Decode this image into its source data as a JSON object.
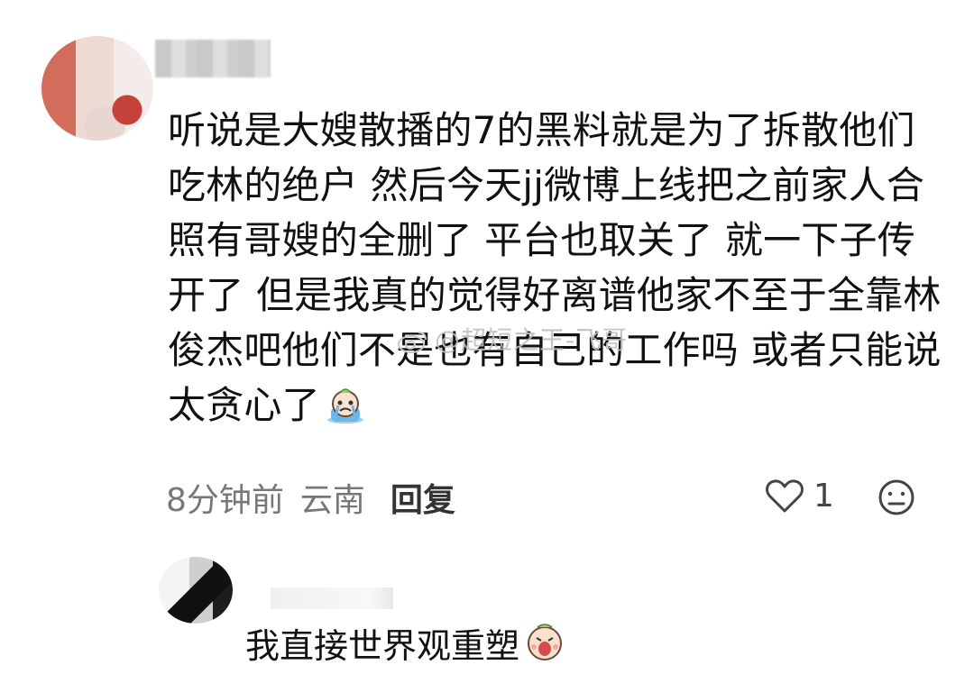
{
  "comment": {
    "text": "听说是大嫂散播的7的黑料就是为了拆散他们吃林的绝户 然后今天jj微博上线把之前家人合照有哥嫂的全删了 平台也取关了 就一下子传开了 但是我真的觉得好离谱他家不至于全靠林俊杰吧他们不是也有自己的工作吗 或者只能说太贪心了",
    "emoji": "crying-face-emoji",
    "time": "8分钟前",
    "location": "云南",
    "reply_label": "回复",
    "like_count": "1"
  },
  "watermark": {
    "text": "@超短之王-飞哥"
  },
  "reply": {
    "text": "我直接世界观重塑",
    "emoji": "screaming-face-emoji"
  },
  "colors": {
    "text": "#111111",
    "meta": "#777777",
    "watermark": "#bebebe"
  }
}
